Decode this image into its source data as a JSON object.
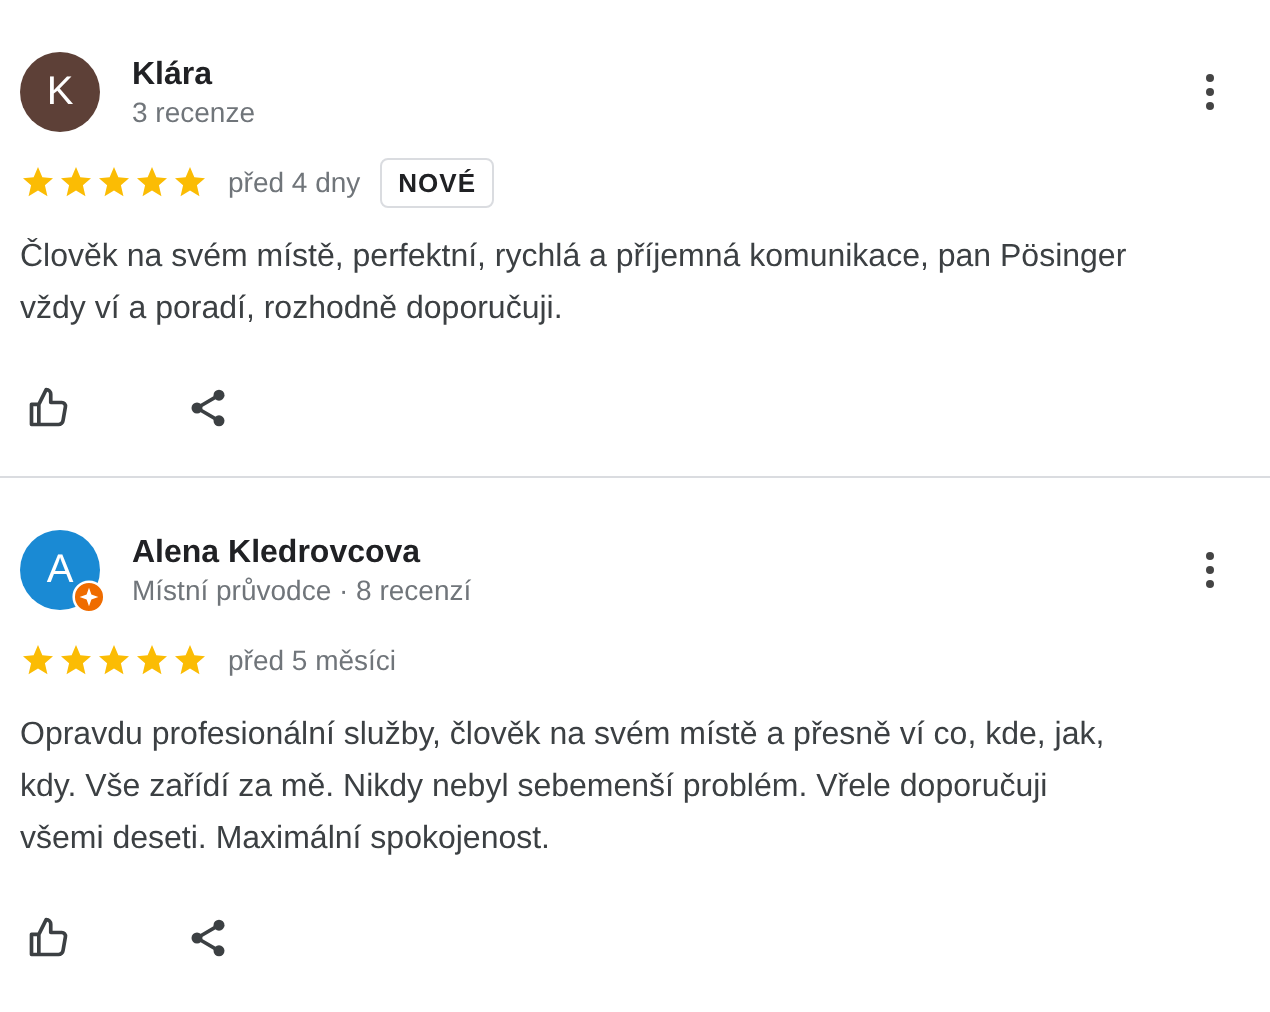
{
  "reviews": [
    {
      "avatar_letter": "K",
      "color": "#5d4037",
      "local_guide": false,
      "name": "Klára",
      "meta": "3 recenze",
      "stars": 5,
      "time": "před 4 dny",
      "badge": "NOVÉ",
      "text": "Člověk na svém místě, perfektní, rychlá a příjemná komunikace, pan Pösinger vždy ví a poradí, rozhodně doporučuji."
    },
    {
      "avatar_letter": "A",
      "color": "#1a8ad4",
      "local_guide": true,
      "name": "Alena Kledrovcova",
      "meta": "Místní průvodce · 8 recenzí",
      "stars": 5,
      "time": "před 5 měsíci",
      "text": "Opravdu profesionální služby, člověk na svém místě a přesně ví co, kde, jak, kdy. Vše zařídí za mě. Nikdy nebyl sebemenší problém. Vřele doporučuji všemi deseti. Maximální spokojenost."
    }
  ]
}
